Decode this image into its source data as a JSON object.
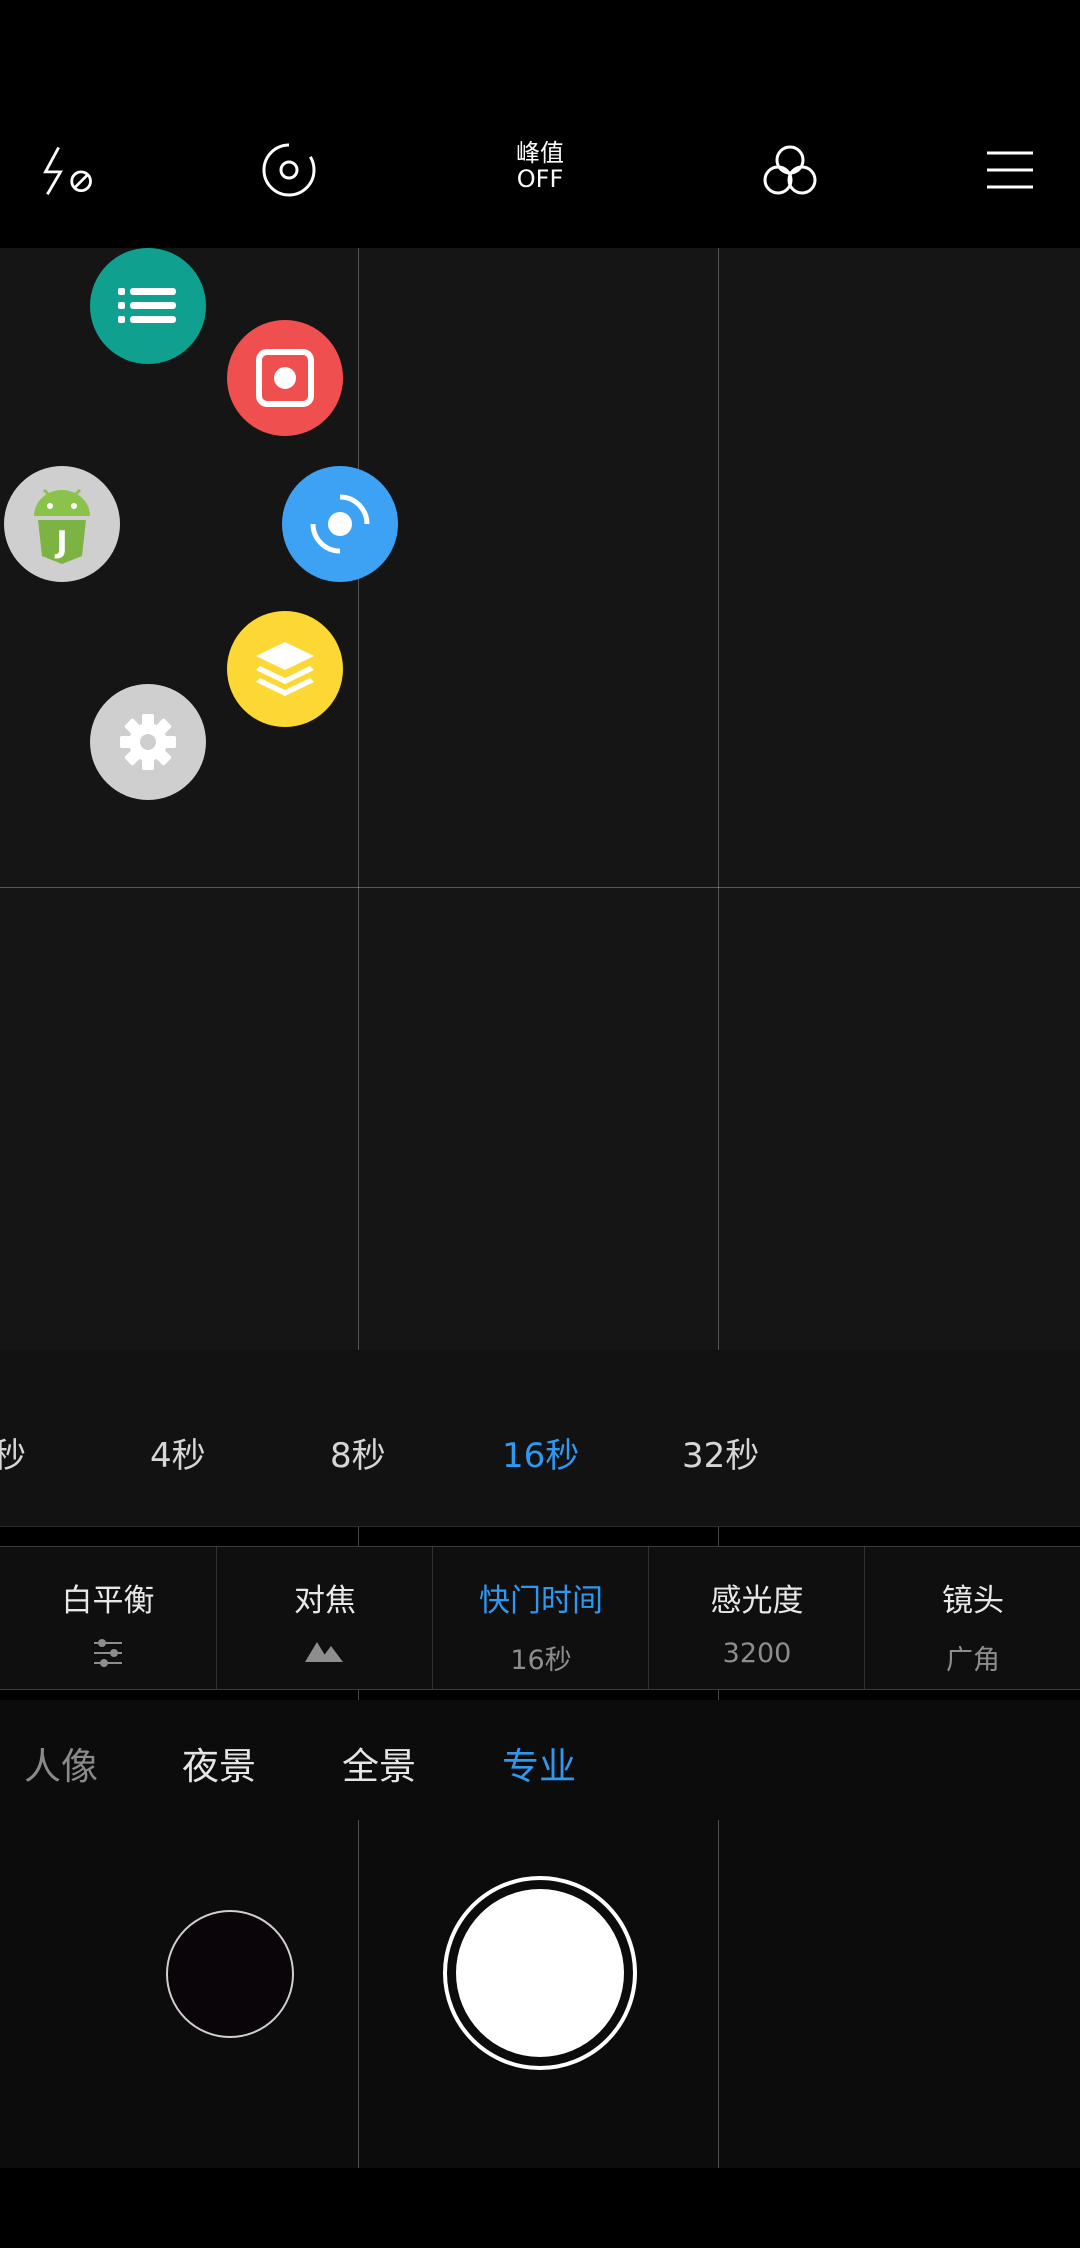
{
  "top_bar": {
    "icons": [
      "flash-off-icon",
      "live-focus-icon",
      "filters-icon",
      "menu-icon"
    ],
    "peak": {
      "line1": "峰值",
      "line2": "OFF"
    }
  },
  "floating_menu": {
    "items": [
      "list-icon",
      "record-icon",
      "android-j-icon",
      "camera-lens-icon",
      "layers-icon",
      "settings-icon"
    ],
    "colors": {
      "list": "#10a090",
      "record": "#ef4f4f",
      "android": "#cfcfcf",
      "lens": "#3ea2f4",
      "layers": "#fdd835",
      "settings": "#cfcfcf"
    }
  },
  "shutter_values": {
    "items": [
      "秒",
      "4秒",
      "8秒",
      "16秒",
      "32秒"
    ],
    "selected": "16秒"
  },
  "params": [
    {
      "name": "白平衡",
      "sub": ""
    },
    {
      "name": "对焦",
      "sub": ""
    },
    {
      "name": "快门时间",
      "sub": "16秒"
    },
    {
      "name": "感光度",
      "sub": "3200"
    },
    {
      "name": "镜头",
      "sub": "广角"
    }
  ],
  "modes": {
    "items": [
      "人像",
      "夜景",
      "全景",
      "专业"
    ],
    "selected": "专业"
  },
  "accent_color": "#2f98f0"
}
